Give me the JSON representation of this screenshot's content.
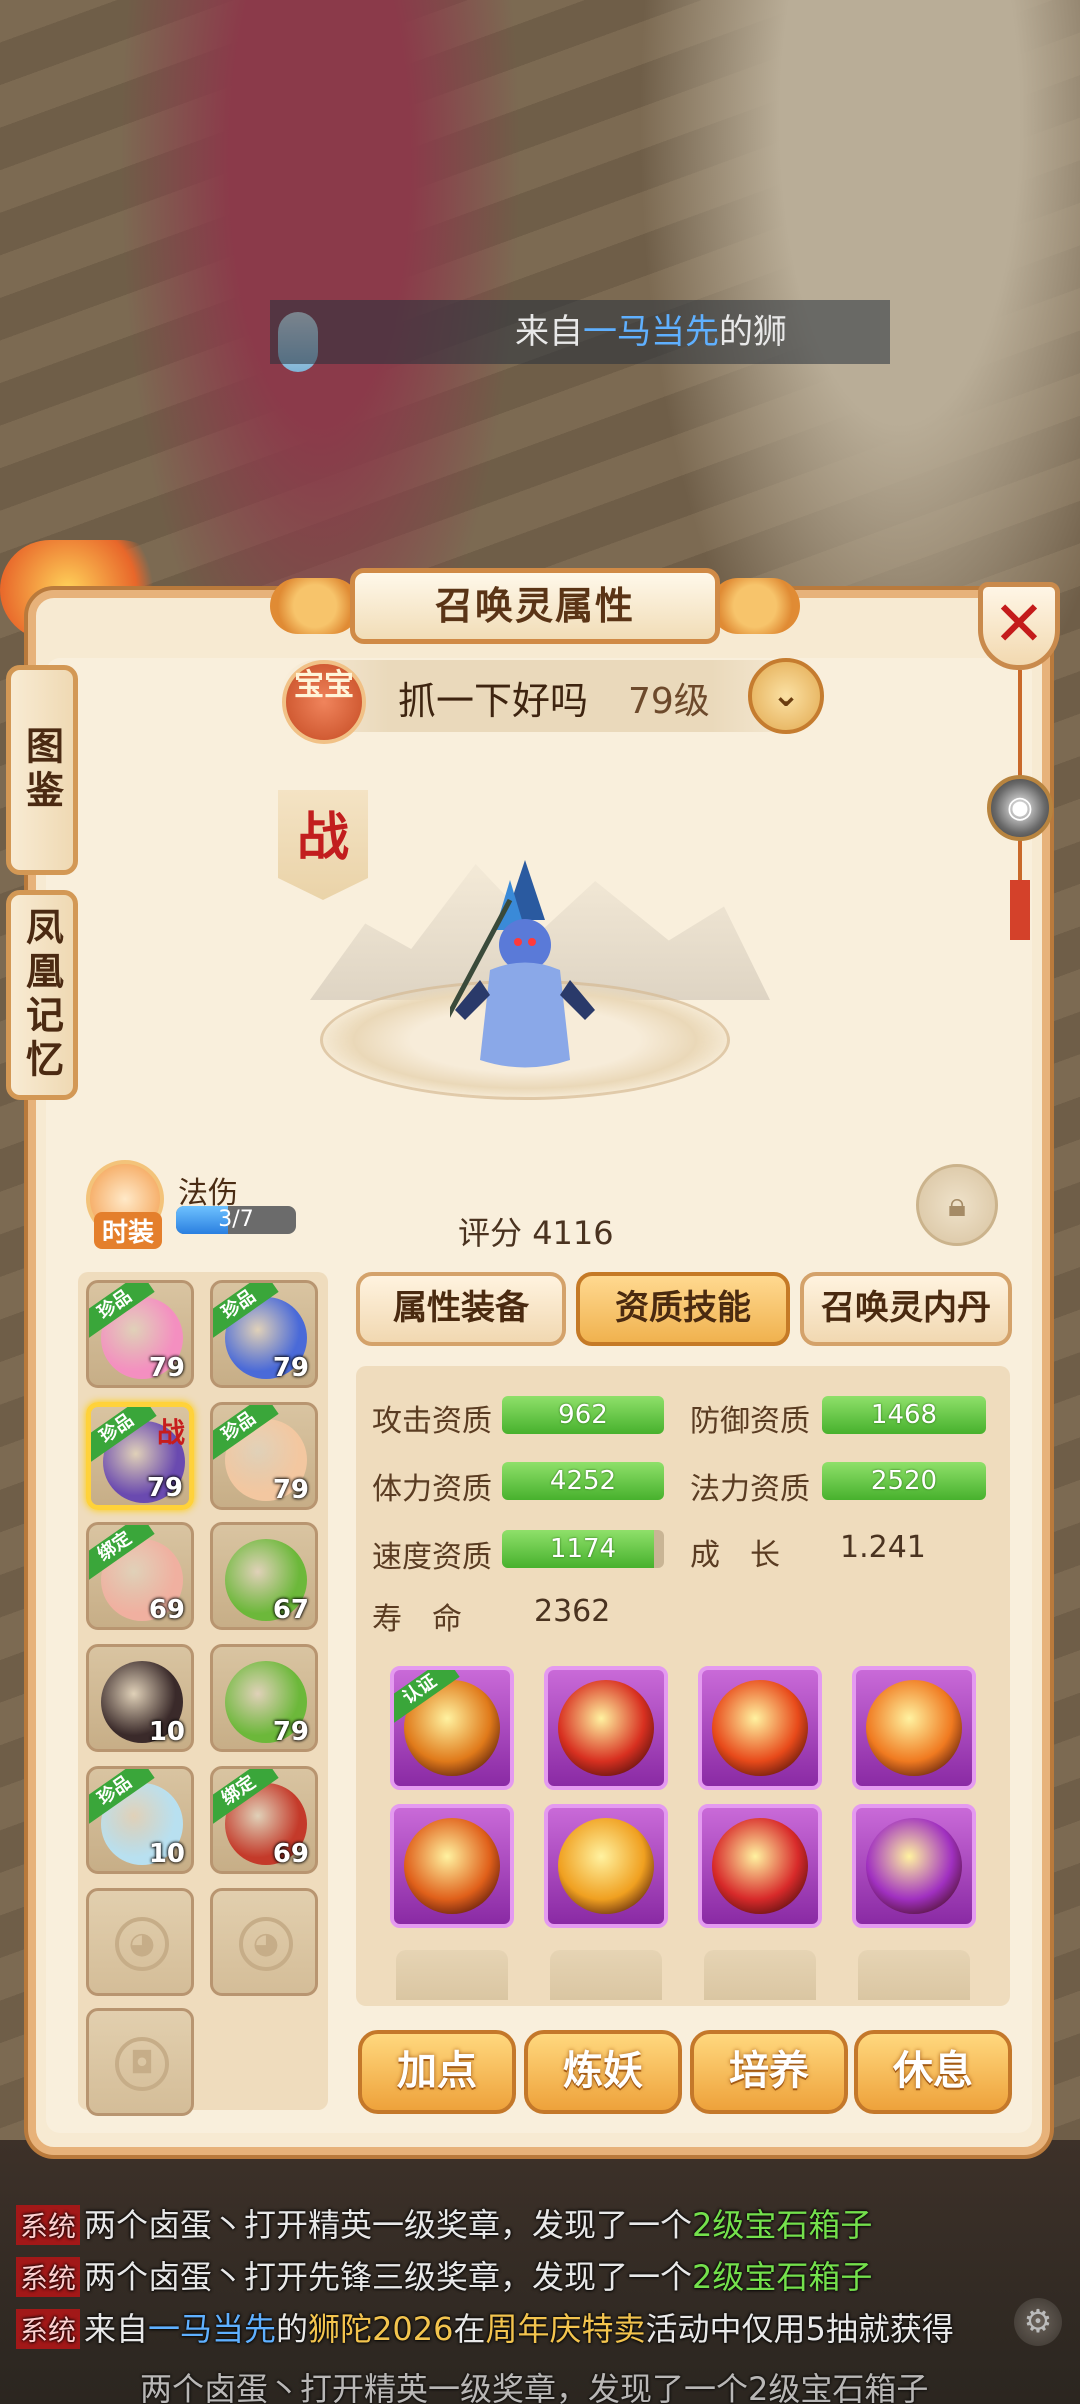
{
  "top_message": {
    "prefix": "来自",
    "player": "一马当先",
    "suffix": "的狮"
  },
  "window": {
    "title": "召唤灵属性",
    "close_glyph": "✕"
  },
  "side_tabs": [
    {
      "label": "图鉴"
    },
    {
      "label": "凤凰记忆"
    }
  ],
  "pet": {
    "badge": "宝宝",
    "name": "抓一下好吗",
    "level": "79级",
    "battle_mark": "战",
    "score_label": "评分",
    "score_value": "4116"
  },
  "fashion": {
    "label": "时装",
    "skill_text": "法伤",
    "progress_text": "3/7",
    "progress_fraction": 0.43
  },
  "tabs": [
    {
      "label": "属性装备",
      "active": false
    },
    {
      "label": "资质技能",
      "active": true
    },
    {
      "label": "召唤灵内丹",
      "active": false
    }
  ],
  "pet_list": [
    {
      "level": "79",
      "tag": "珍品",
      "color": "#f48fc0",
      "selected": false,
      "in_battle": false
    },
    {
      "level": "79",
      "tag": "珍品",
      "color": "#4a6ad8",
      "selected": false,
      "in_battle": false
    },
    {
      "level": "79",
      "tag": "珍品",
      "color": "#6a4ab0",
      "selected": true,
      "in_battle": true
    },
    {
      "level": "79",
      "tag": "珍品",
      "color": "#f3c7a0",
      "selected": false,
      "in_battle": false
    },
    {
      "level": "69",
      "tag": "绑定",
      "color": "#f0b0a0",
      "selected": false,
      "in_battle": false
    },
    {
      "level": "67",
      "tag": "",
      "color": "#6cb83a",
      "selected": false,
      "in_battle": false
    },
    {
      "level": "10",
      "tag": "",
      "color": "#3a2a2a",
      "selected": false,
      "in_battle": false
    },
    {
      "level": "79",
      "tag": "",
      "color": "#6cb83a",
      "selected": false,
      "in_battle": false
    },
    {
      "level": "10",
      "tag": "珍品",
      "color": "#b8e0f0",
      "selected": false,
      "in_battle": false
    },
    {
      "level": "69",
      "tag": "绑定",
      "color": "#c43a2a",
      "selected": false,
      "in_battle": false
    }
  ],
  "attributes": {
    "attack": {
      "label": "攻击资质",
      "value": "962",
      "fraction": 1.0
    },
    "defense": {
      "label": "防御资质",
      "value": "1468",
      "fraction": 1.0
    },
    "hp": {
      "label": "体力资质",
      "value": "4252",
      "fraction": 1.0
    },
    "magic": {
      "label": "法力资质",
      "value": "2520",
      "fraction": 1.0
    },
    "speed": {
      "label": "速度资质",
      "value": "1174",
      "fraction": 0.94
    },
    "growth": {
      "label": "成　长",
      "value": "1.241"
    },
    "life": {
      "label": "寿　命",
      "value": "2362"
    }
  },
  "skills": [
    {
      "name": "skill-1",
      "certified": true,
      "cert_label": "认证",
      "color": "#e07a1a"
    },
    {
      "name": "skill-2",
      "certified": false,
      "cert_label": "",
      "color": "#d83020"
    },
    {
      "name": "skill-3",
      "certified": false,
      "cert_label": "",
      "color": "#e84a1a"
    },
    {
      "name": "skill-4",
      "certified": false,
      "cert_label": "",
      "color": "#f07a20"
    },
    {
      "name": "skill-5",
      "certified": false,
      "cert_label": "",
      "color": "#e0601a"
    },
    {
      "name": "skill-6",
      "certified": false,
      "cert_label": "",
      "color": "#f0a020"
    },
    {
      "name": "skill-7",
      "certified": false,
      "cert_label": "",
      "color": "#d82a2a"
    },
    {
      "name": "skill-8",
      "certified": false,
      "cert_label": "",
      "color": "#a030c0"
    }
  ],
  "actions": [
    {
      "label": "加点"
    },
    {
      "label": "炼妖"
    },
    {
      "label": "培养"
    },
    {
      "label": "休息"
    }
  ],
  "chat": [
    {
      "tag": "系统",
      "a": "两个卤蛋丶",
      "b": "打开精英一级奖章，发现了一个",
      "c": "2级宝石箱子"
    },
    {
      "tag": "系统",
      "a": "两个卤蛋丶",
      "b": "打开先锋三级奖章，发现了一个",
      "c": "2级宝石箱子"
    },
    {
      "tag": "系统",
      "a": "来自",
      "b": "一马当先",
      "c": "的",
      "d": "狮陀2026",
      "e": "在",
      "f": "周年庆特卖",
      "g": "活动中仅用5抽就获得"
    },
    {
      "partial": "两个卤蛋丶打开精英一级奖章，发现了一个2级宝石箱子"
    }
  ],
  "colors": {
    "panel_bg": "#f7ead2",
    "panel_border": "#e7b27a",
    "accent_orange": "#f0b24f",
    "bar_green": "#47b12d",
    "close_red": "#c41b1b"
  }
}
